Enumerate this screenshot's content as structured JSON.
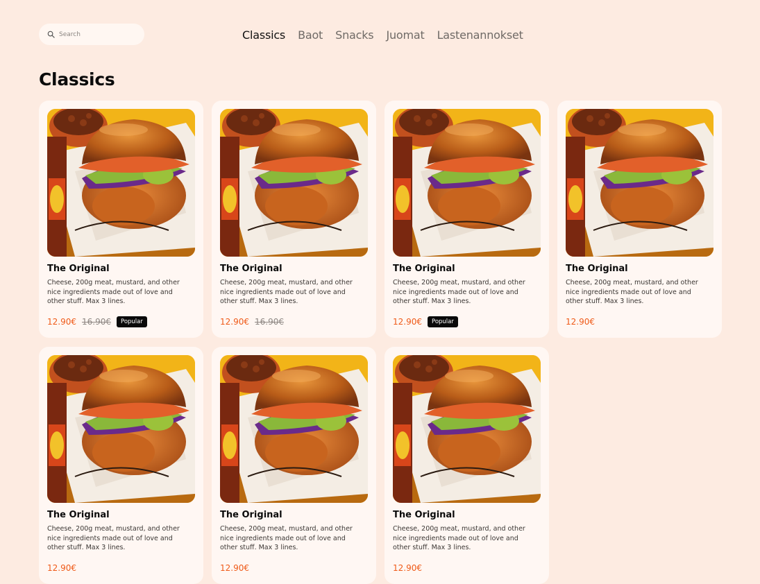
{
  "search": {
    "placeholder": "Search"
  },
  "nav": {
    "items": [
      {
        "label": "Classics",
        "active": true
      },
      {
        "label": "Baot",
        "active": false
      },
      {
        "label": "Snacks",
        "active": false
      },
      {
        "label": "Juomat",
        "active": false
      },
      {
        "label": "Lastenannokset",
        "active": false
      }
    ]
  },
  "section": {
    "title": "Classics"
  },
  "products": [
    {
      "name": "The Original",
      "description": "Cheese, 200g meat, mustard, and other nice ingredients made out of love and other stuff. Max 3 lines.",
      "price": "12.90€",
      "old_price": "16.90€",
      "badge": "Popular"
    },
    {
      "name": "The Original",
      "description": "Cheese, 200g meat, mustard, and other nice ingredients made out of love and other stuff. Max 3 lines.",
      "price": "12.90€",
      "old_price": "16.90€",
      "badge": ""
    },
    {
      "name": "The Original",
      "description": "Cheese, 200g meat, mustard, and other nice ingredients made out of love and other stuff. Max 3 lines.",
      "price": "12.90€",
      "old_price": "",
      "badge": "Popular"
    },
    {
      "name": "The Original",
      "description": "Cheese, 200g meat, mustard, and other nice ingredients made out of love and other stuff. Max 3 lines.",
      "price": "12.90€",
      "old_price": "",
      "badge": ""
    },
    {
      "name": "The Original",
      "description": "Cheese, 200g meat, mustard, and other nice ingredients made out of love and other stuff. Max 3 lines.",
      "price": "12.90€",
      "old_price": "",
      "badge": ""
    },
    {
      "name": "The Original",
      "description": "Cheese, 200g meat, mustard, and other nice ingredients made out of love and other stuff. Max 3 lines.",
      "price": "12.90€",
      "old_price": "",
      "badge": ""
    },
    {
      "name": "The Original",
      "description": "Cheese, 200g meat, mustard, and other nice ingredients made out of love and other stuff. Max 3 lines.",
      "price": "12.90€",
      "old_price": "",
      "badge": ""
    }
  ],
  "colors": {
    "background": "#fdebe1",
    "card": "#fff7f3",
    "price": "#ef5a18",
    "badge_bg": "#0a0a0a"
  },
  "icons": {
    "search": "search-icon",
    "product_image": "burger-photo"
  }
}
